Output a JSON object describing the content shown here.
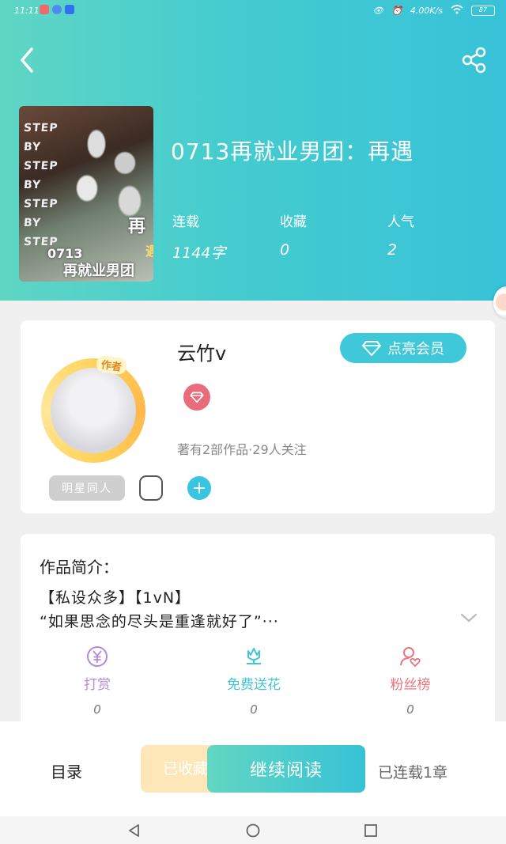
{
  "status_bar": {
    "time": "11:11",
    "net_speed": "4.00K/s",
    "battery": "87"
  },
  "book": {
    "title": "0713再就业男团：再遇",
    "cover": {
      "steps": [
        "STEP",
        "BY",
        "STEP",
        "BY",
        "STEP",
        "BY",
        "STEP"
      ],
      "num": "0713",
      "title": "再就业男团",
      "char1": "再",
      "char2": "遇"
    },
    "stats": [
      {
        "label": "连载",
        "value": "1144字"
      },
      {
        "label": "收藏",
        "value": "0"
      },
      {
        "label": "人气",
        "value": "2"
      }
    ]
  },
  "author": {
    "name": "云竹v",
    "avatar_tag": "作者",
    "meta": "著有2部作品·29人关注",
    "vip_label": "点亮会员",
    "tag_chip": "明星同人"
  },
  "intro": {
    "heading": "作品简介：",
    "line1": "【私设众多】【1vN】",
    "line2": "“如果思念的尽头是重逢就好了”···"
  },
  "actions": [
    {
      "label": "打赏",
      "count": "0",
      "color": "#b48ad8",
      "icon": "yen-circle-icon"
    },
    {
      "label": "免费送花",
      "count": "0",
      "color": "#45c4d6",
      "icon": "flower-icon"
    },
    {
      "label": "粉丝榜",
      "count": "0",
      "color": "#e8747e",
      "icon": "fans-icon"
    }
  ],
  "bottom": {
    "toc": "目录",
    "collected": "已收藏",
    "read": "继续阅读",
    "serial_status": "已连载1章"
  }
}
